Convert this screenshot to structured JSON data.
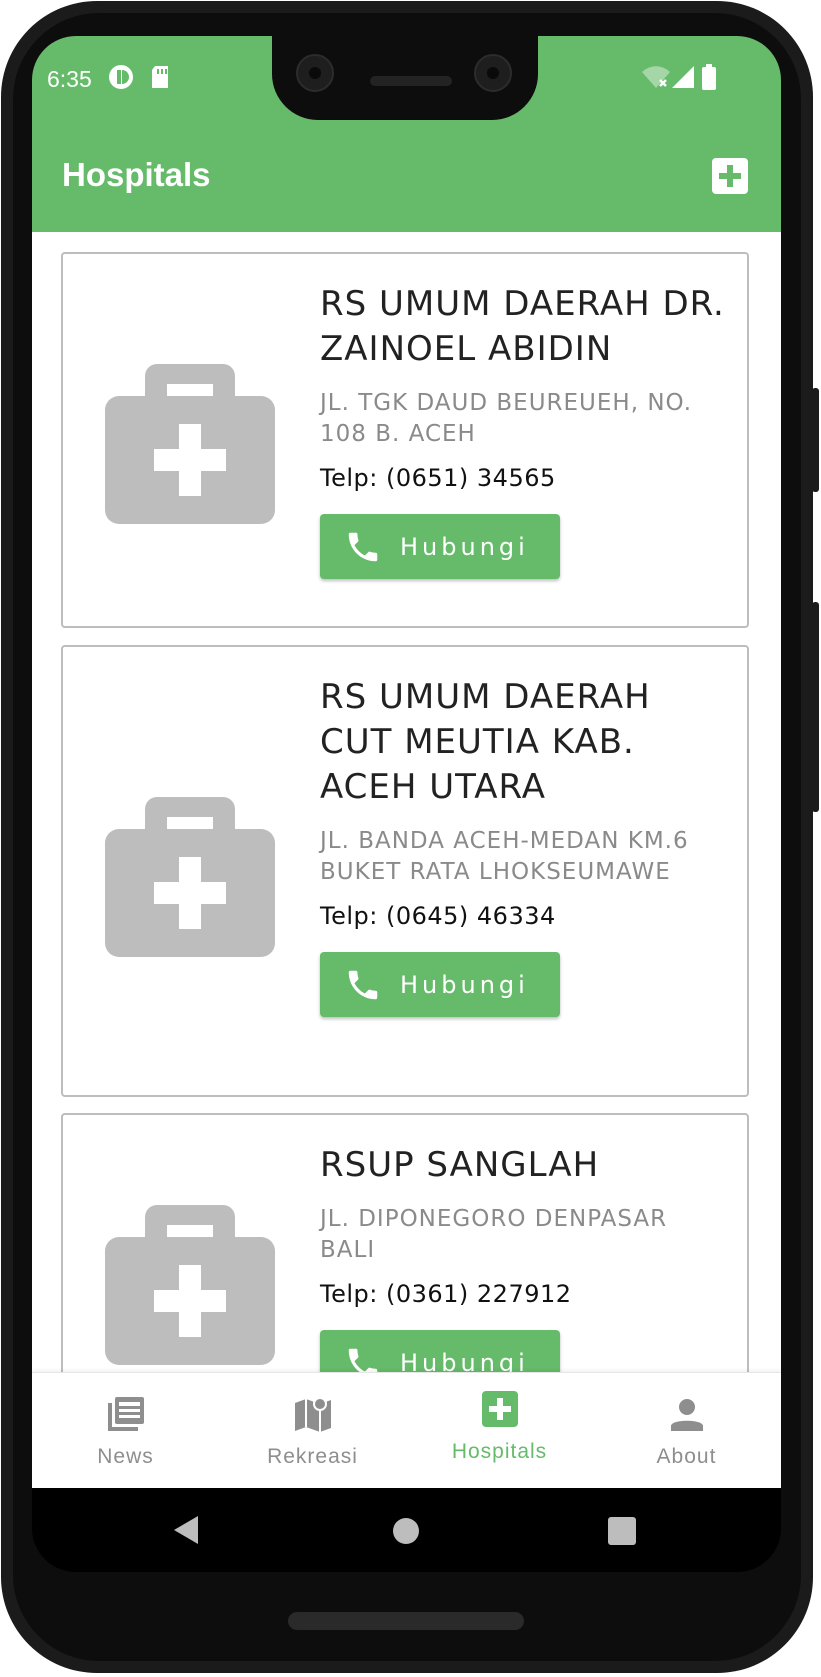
{
  "status_bar": {
    "time": "6:35"
  },
  "app_bar": {
    "title": "Hospitals",
    "add_icon": "add-box-icon",
    "color": "#66bb6a"
  },
  "hospitals": [
    {
      "name": "RS UMUM DAERAH DR. ZAINOEL ABIDIN",
      "address": "JL. TGK DAUD BEUREUEH, NO. 108 B. ACEH",
      "phone": "Telp: (0651) 34565",
      "button": "Hubungi"
    },
    {
      "name": "RS UMUM DAERAH CUT MEUTIA KAB. ACEH UTARA",
      "address": "JL. BANDA ACEH-MEDAN KM.6 BUKET RATA LHOKSEUMAWE",
      "phone": "Telp: (0645) 46334",
      "button": "Hubungi"
    },
    {
      "name": "RSUP SANGLAH",
      "address": "JL. DIPONEGORO DENPASAR BALI",
      "phone": "Telp: (0361) 227912",
      "button": "Hubungi"
    }
  ],
  "bottom_nav": [
    {
      "label": "News",
      "icon": "newspaper-icon",
      "active": false
    },
    {
      "label": "Rekreasi",
      "icon": "map-icon",
      "active": false
    },
    {
      "label": "Hospitals",
      "icon": "hospital-icon",
      "active": true
    },
    {
      "label": "About",
      "icon": "person-icon",
      "active": false
    }
  ],
  "colors": {
    "accent": "#66bb6a",
    "icon_gray": "#bdbdbd",
    "inactive": "#8e8e8e"
  }
}
